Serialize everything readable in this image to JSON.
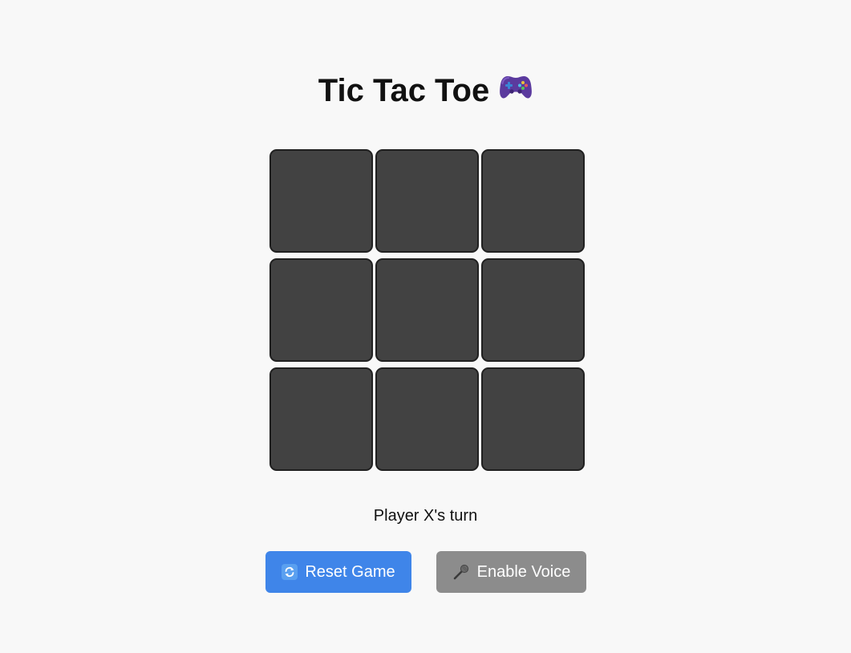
{
  "title": "Tic Tac Toe",
  "title_icon": "game-controller-icon",
  "board": {
    "cells": [
      "",
      "",
      "",
      "",
      "",
      "",
      "",
      "",
      ""
    ]
  },
  "status": "Player X's turn",
  "buttons": {
    "reset_label": "Reset Game",
    "reset_icon": "refresh-icon",
    "voice_label": "Enable Voice",
    "voice_icon": "microphone-icon"
  },
  "colors": {
    "background": "#f8f8f8",
    "cell": "#424242",
    "cell_border": "#202020",
    "reset_button": "#3f85e9",
    "voice_button": "#8c8c8c"
  }
}
